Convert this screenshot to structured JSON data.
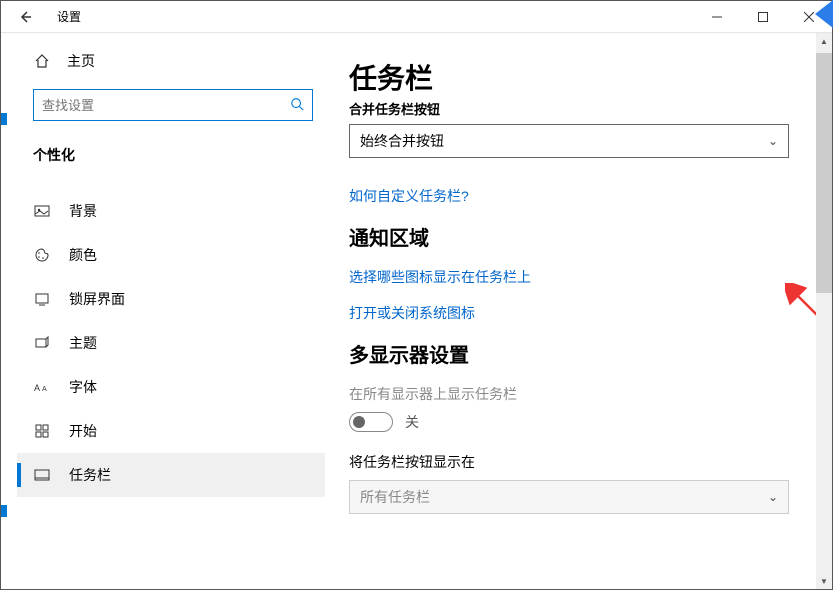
{
  "titlebar": {
    "title": "设置"
  },
  "sidebar": {
    "home_label": "主页",
    "search_placeholder": "查找设置",
    "section_title": "个性化",
    "items": [
      {
        "label": "背景"
      },
      {
        "label": "颜色"
      },
      {
        "label": "锁屏界面"
      },
      {
        "label": "主题"
      },
      {
        "label": "字体"
      },
      {
        "label": "开始"
      },
      {
        "label": "任务栏"
      }
    ]
  },
  "main": {
    "page_title": "任务栏",
    "combine_label": "合并任务栏按钮",
    "combine_value": "始终合并按钮",
    "customize_link": "如何自定义任务栏?",
    "notification_header": "通知区域",
    "select_icons_link": "选择哪些图标显示在任务栏上",
    "system_icons_link": "打开或关闭系统图标",
    "multi_display_header": "多显示器设置",
    "show_all_label": "在所有显示器上显示任务栏",
    "toggle_state": "关",
    "show_buttons_label": "将任务栏按钮显示在",
    "show_buttons_value": "所有任务栏"
  }
}
